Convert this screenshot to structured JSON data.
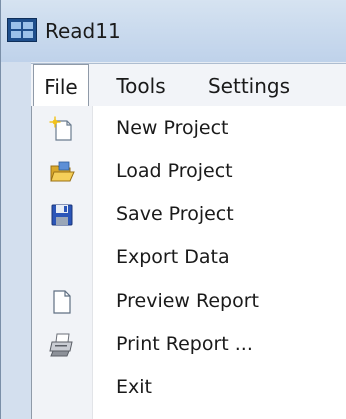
{
  "window": {
    "title": "Read11"
  },
  "menubar": {
    "items": [
      {
        "label": "File"
      },
      {
        "label": "Tools"
      },
      {
        "label": "Settings"
      }
    ]
  },
  "file_menu": {
    "items": [
      {
        "label": "New Project",
        "icon": "new-document-icon"
      },
      {
        "label": "Load Project",
        "icon": "open-folder-icon"
      },
      {
        "label": "Save Project",
        "icon": "floppy-disk-icon"
      },
      {
        "label": "Export Data",
        "icon": ""
      },
      {
        "label": "Preview Report",
        "icon": "blank-page-icon"
      },
      {
        "label": "Print Report ...",
        "icon": "printer-icon"
      },
      {
        "label": "Exit",
        "icon": ""
      }
    ]
  },
  "colors": {
    "titlebar": "#cbdbee",
    "menubar": "#f2f4f8",
    "dropdown": "#ffffff",
    "icon_gutter": "#f1f3f7"
  }
}
